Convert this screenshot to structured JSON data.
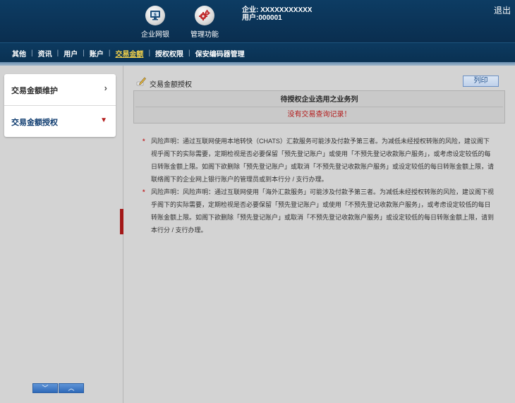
{
  "header": {
    "buttons": [
      {
        "label": "企业网银",
        "icon": "monitor-icon"
      },
      {
        "label": "管理功能",
        "icon": "gears-icon"
      }
    ],
    "company": "企业: XXXXXXXXXXX",
    "user": "用户:000001",
    "logout": "退出"
  },
  "nav": {
    "items": [
      "其他",
      "资讯",
      "用户",
      "账户",
      "交易金额",
      "授权权限",
      "保安编码器管理"
    ],
    "active_index": 4,
    "active_color": "#f3d24a"
  },
  "sidebar": {
    "items": [
      {
        "label": "交易金额维护",
        "icon": "chevron-right-icon"
      },
      {
        "label": "交易金额授权",
        "icon": "chevron-down-icon"
      }
    ],
    "active_index": 1,
    "scroll_down": "﹀",
    "scroll_up": "︿"
  },
  "main": {
    "title": "交易金额授权",
    "list_button": "列印",
    "table_header": "待授权企业选用之业务列",
    "empty_message": "没有交易查询记录！",
    "notes": [
      "风险声明：通过互联网使用本地转快（CHATS）汇款服务可能涉及付款予第三者。为减低未经授权转账的风险，建议阁下视乎阁下的实际需要，定期检视是否必要保留「预先登记账户」或使用「不预先登记收款账户服务」，或考虑设定较低的每日转账金额上限。如阁下欲删除「预先登记账户」或取消「不预先登记收款账户服务」或设定较低的每日转账金额上限，请联络阁下的企业网上银行账户的管理员或到本行分 / 支行办理。",
      "风险声明：风险声明：通过互联网使用「海外汇款服务」可能涉及付款予第三者。为减低未经授权转账的风险，建议阁下视乎阁下的实际需要，定期检视是否必要保留「预先登记账户」或使用「不预先登记收款账户服务」，或考虑设定较低的每日转账金额上限。如阁下欲删除「预先登记账户」或取消「不预先登记收款账户服务」或设定较低的每日转账金额上限，请到本行分 / 支行办理。"
    ]
  }
}
